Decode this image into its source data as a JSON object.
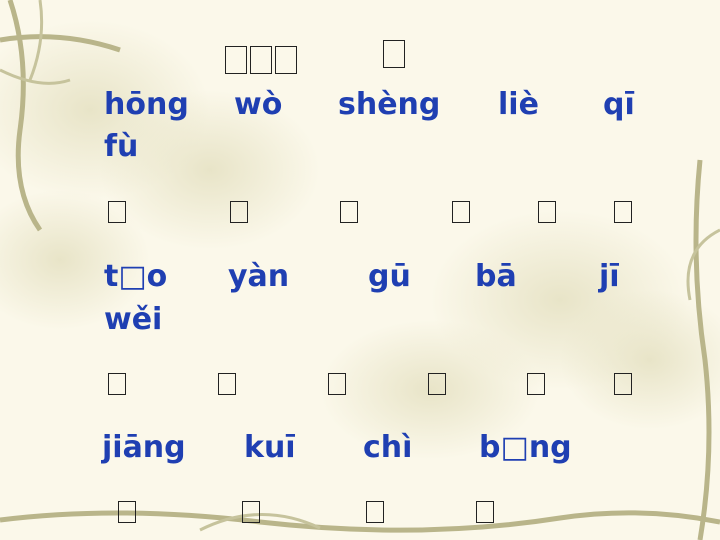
{
  "title_boxes": [
    "□",
    "□",
    "□",
    "□"
  ],
  "rows": [
    {
      "words": [
        "hōng",
        "wò",
        "shèng",
        "liè",
        "qī",
        "fù"
      ]
    },
    {
      "words": [
        "t□o",
        "yàn",
        "gū",
        "bā",
        "jī",
        "wěi"
      ]
    },
    {
      "words": [
        "jiāng",
        "kuī",
        "chì",
        "b□ng"
      ]
    }
  ],
  "answer_boxes": [
    [
      "□",
      "□",
      "□",
      "□",
      "□",
      "□"
    ],
    [
      "□",
      "□",
      "□",
      "□",
      "□",
      "□"
    ],
    [
      "□",
      "□",
      "□",
      "□"
    ]
  ]
}
